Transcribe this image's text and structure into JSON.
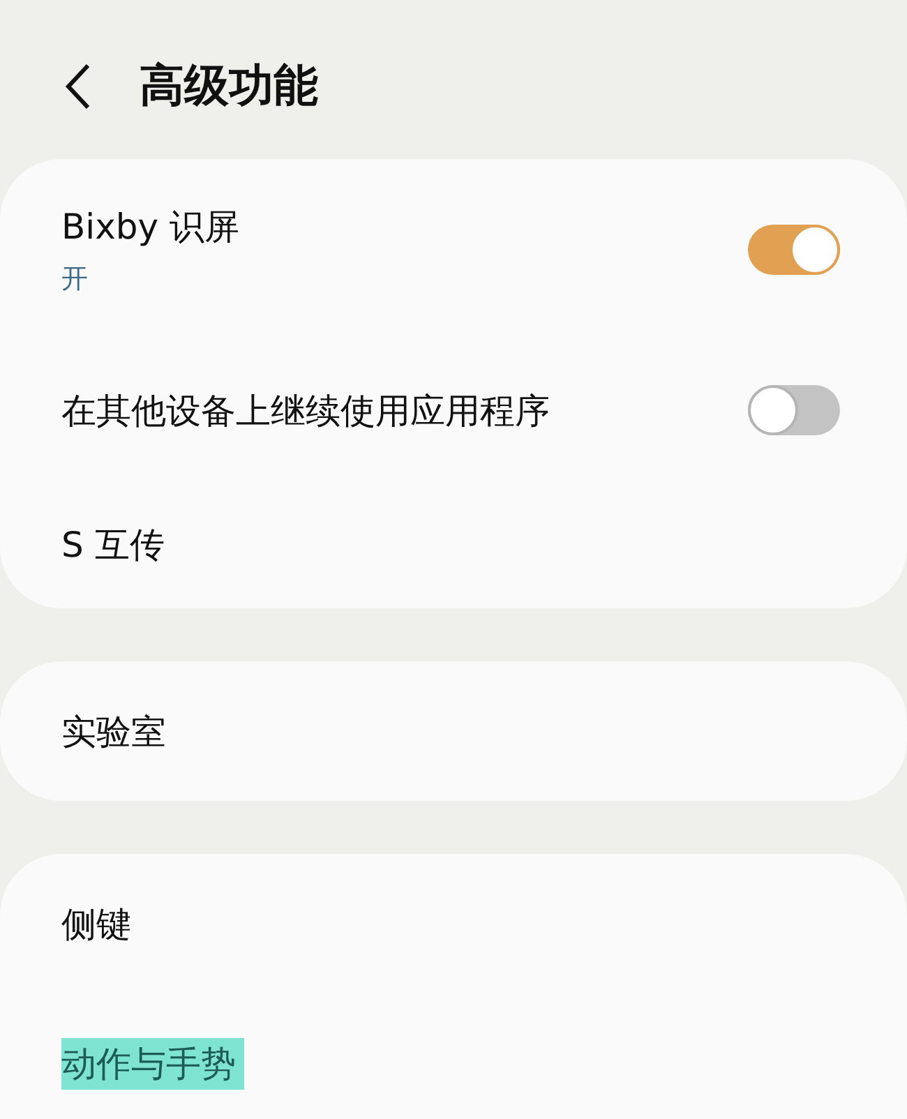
{
  "header": {
    "title": "高级功能"
  },
  "groups": [
    {
      "items": [
        {
          "kind": "toggle",
          "label": "Bixby 识屏",
          "sub": "开",
          "on": true
        },
        {
          "kind": "toggle",
          "label": "在其他设备上继续使用应用程序",
          "on": false
        },
        {
          "kind": "link",
          "label": "S 互传",
          "highlighted": false
        }
      ]
    },
    {
      "items": [
        {
          "kind": "link",
          "label": "实验室",
          "highlighted": false
        }
      ]
    },
    {
      "items": [
        {
          "kind": "link",
          "label": "侧键",
          "highlighted": false
        },
        {
          "kind": "link",
          "label": "动作与手势",
          "highlighted": true
        }
      ]
    }
  ]
}
